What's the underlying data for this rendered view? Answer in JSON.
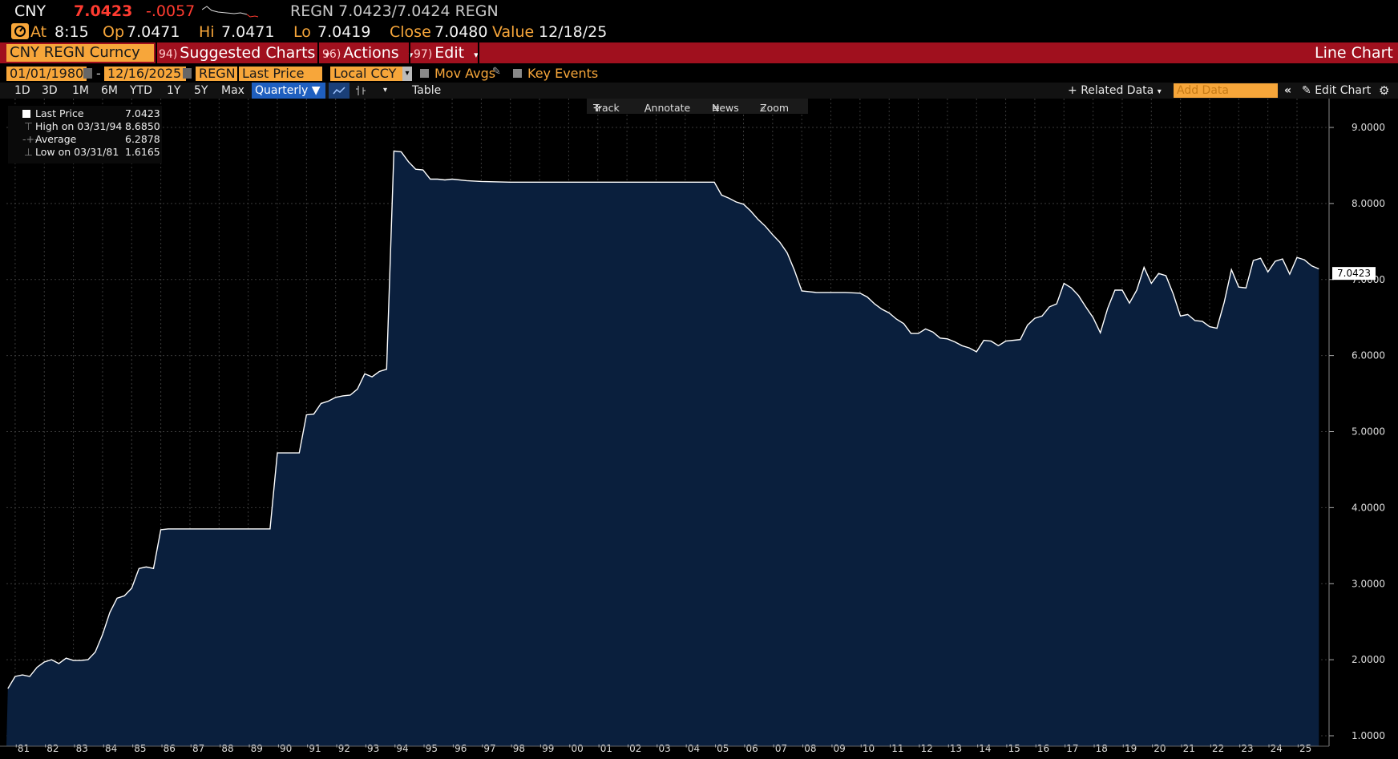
{
  "quote": {
    "ticker": "CNY",
    "last": "7.0423",
    "change": "-.0057",
    "bid_ask": "REGN 7.0423/7.0424 REGN",
    "at_label": "At",
    "at_time": "8:15",
    "op_label": "Op",
    "op": "7.0471",
    "hi_label": "Hi",
    "hi": "7.0471",
    "lo_label": "Lo",
    "lo": "7.0419",
    "close_label": "Close",
    "close": "7.0480",
    "value_label": "Value",
    "value_date": "12/18/25"
  },
  "menu": {
    "security": "CNY REGN Curncy",
    "suggested_num": "94)",
    "suggested": "Suggested Charts",
    "actions_num": "96)",
    "actions": "Actions",
    "edit_num": "97)",
    "edit": "Edit",
    "chart_type": "Line Chart"
  },
  "controls": {
    "start_date": "01/01/1980",
    "end_date": "12/16/2025",
    "source": "REGN",
    "field": "Last Price",
    "currency": "Local CCY",
    "mov_avgs": "Mov Avgs",
    "key_events": "Key Events"
  },
  "timeframes": [
    "1D",
    "3D",
    "1M",
    "6M",
    "YTD",
    "1Y",
    "5Y",
    "Max"
  ],
  "periodicity": "Quarterly",
  "table_label": "Table",
  "related_data": "Related Data",
  "add_data_placeholder": "Add Data",
  "edit_chart": "Edit Chart",
  "tools": {
    "track": "Track",
    "annotate": "Annotate",
    "news": "News",
    "zoom": "Zoom"
  },
  "legend": [
    {
      "label": "Last Price",
      "value": "7.0423"
    },
    {
      "label": "High on 03/31/94",
      "value": "8.6850"
    },
    {
      "label": "Average",
      "value": "6.2878"
    },
    {
      "label": "Low on 03/31/81",
      "value": "1.6165"
    }
  ],
  "colors": {
    "accent": "#f7a63a",
    "menu_bar": "#a0101e",
    "area_fill": "#0a1f3d",
    "line": "#ffffff",
    "down": "#ff3b30"
  },
  "chart_data": {
    "type": "area",
    "ylim": [
      1.0,
      9.0
    ],
    "yticks": [
      "1.0000",
      "2.0000",
      "3.0000",
      "4.0000",
      "5.0000",
      "6.0000",
      "7.0000",
      "8.0000",
      "9.0000"
    ],
    "xticks": [
      "'81",
      "'82",
      "'83",
      "'84",
      "'85",
      "'86",
      "'87",
      "'88",
      "'89",
      "'90",
      "'91",
      "'92",
      "'93",
      "'94",
      "'95",
      "'96",
      "'97",
      "'98",
      "'99",
      "'00",
      "'01",
      "'02",
      "'03",
      "'04",
      "'05",
      "'06",
      "'07",
      "'08",
      "'09",
      "'10",
      "'11",
      "'12",
      "'13",
      "'14",
      "'15",
      "'16",
      "'17",
      "'18",
      "'19",
      "'20",
      "'21",
      "'22",
      "'23",
      "'24",
      "'25"
    ],
    "last_label": "7.0423",
    "x": [
      1980.75,
      1981.0,
      1981.25,
      1981.5,
      1981.75,
      1982.0,
      1982.25,
      1982.5,
      1982.75,
      1983.0,
      1983.25,
      1983.5,
      1983.75,
      1984.0,
      1984.25,
      1984.5,
      1984.75,
      1985.0,
      1985.25,
      1985.5,
      1985.75,
      1986.0,
      1986.25,
      1986.5,
      1986.75,
      1987.0,
      1988.0,
      1989.0,
      1989.75,
      1990.0,
      1990.75,
      1991.0,
      1991.25,
      1991.5,
      1991.75,
      1992.0,
      1992.25,
      1992.5,
      1992.75,
      1993.0,
      1993.25,
      1993.5,
      1993.75,
      1994.0,
      1994.25,
      1994.5,
      1994.75,
      1995.0,
      1995.25,
      1995.5,
      1995.75,
      1996.0,
      1996.5,
      1997.0,
      1998.0,
      1999.0,
      2000.0,
      2001.0,
      2002.0,
      2003.0,
      2004.0,
      2005.0,
      2005.25,
      2005.5,
      2005.75,
      2006.0,
      2006.25,
      2006.5,
      2006.75,
      2007.0,
      2007.25,
      2007.5,
      2007.75,
      2008.0,
      2008.25,
      2008.5,
      2009.0,
      2009.5,
      2010.0,
      2010.25,
      2010.5,
      2010.75,
      2011.0,
      2011.25,
      2011.5,
      2011.75,
      2012.0,
      2012.25,
      2012.5,
      2012.75,
      2013.0,
      2013.25,
      2013.5,
      2013.75,
      2014.0,
      2014.25,
      2014.5,
      2014.75,
      2015.0,
      2015.5,
      2015.75,
      2016.0,
      2016.25,
      2016.5,
      2016.75,
      2017.0,
      2017.25,
      2017.5,
      2017.75,
      2018.0,
      2018.25,
      2018.5,
      2018.75,
      2019.0,
      2019.25,
      2019.5,
      2019.75,
      2020.0,
      2020.25,
      2020.5,
      2020.75,
      2021.0,
      2021.25,
      2021.5,
      2021.75,
      2022.0,
      2022.25,
      2022.5,
      2022.75,
      2023.0,
      2023.25,
      2023.5,
      2023.75,
      2024.0,
      2024.25,
      2024.5,
      2024.75,
      2025.0,
      2025.25,
      2025.5,
      2025.75
    ],
    "y": [
      1.62,
      1.78,
      1.8,
      1.78,
      1.9,
      1.97,
      2.0,
      1.95,
      2.02,
      1.99,
      1.99,
      2.0,
      2.1,
      2.33,
      2.62,
      2.81,
      2.84,
      2.94,
      3.2,
      3.22,
      3.2,
      3.71,
      3.72,
      3.72,
      3.72,
      3.72,
      3.72,
      3.72,
      3.72,
      4.72,
      4.72,
      5.22,
      5.23,
      5.37,
      5.4,
      5.45,
      5.47,
      5.48,
      5.56,
      5.76,
      5.72,
      5.79,
      5.82,
      8.69,
      8.68,
      8.55,
      8.45,
      8.44,
      8.32,
      8.32,
      8.31,
      8.32,
      8.3,
      8.29,
      8.28,
      8.28,
      8.28,
      8.28,
      8.28,
      8.28,
      8.28,
      8.28,
      8.11,
      8.07,
      8.02,
      7.99,
      7.9,
      7.79,
      7.7,
      7.59,
      7.49,
      7.35,
      7.12,
      6.85,
      6.84,
      6.83,
      6.83,
      6.83,
      6.82,
      6.77,
      6.68,
      6.61,
      6.56,
      6.48,
      6.42,
      6.29,
      6.29,
      6.35,
      6.31,
      6.23,
      6.22,
      6.18,
      6.13,
      6.1,
      6.05,
      6.2,
      6.19,
      6.13,
      6.19,
      6.21,
      6.4,
      6.49,
      6.52,
      6.64,
      6.68,
      6.95,
      6.89,
      6.79,
      6.64,
      6.5,
      6.3,
      6.62,
      6.86,
      6.86,
      6.69,
      6.86,
      7.16,
      6.95,
      7.08,
      7.05,
      6.81,
      6.52,
      6.54,
      6.46,
      6.45,
      6.38,
      6.36,
      6.7,
      7.13,
      6.9,
      6.89,
      7.25,
      7.28,
      7.1,
      7.24,
      7.27,
      7.07,
      7.29,
      7.26,
      7.18,
      7.14,
      7.08
    ]
  }
}
